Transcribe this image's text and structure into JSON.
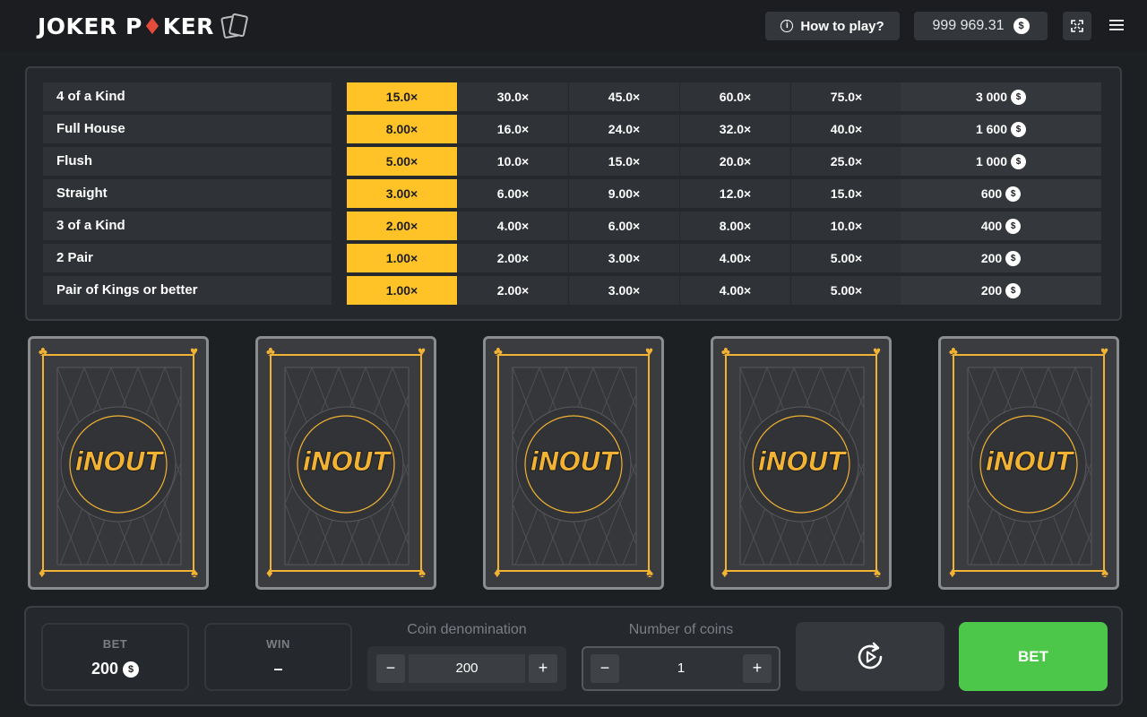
{
  "header": {
    "logo_text_1": "JOKER P",
    "logo_diamond": "♦",
    "logo_text_2": "KER",
    "how_to_play": "How to play?",
    "info_icon": "i",
    "balance": "999 969.31",
    "coin_symbol": "$"
  },
  "paytable": {
    "rows": [
      {
        "name": "4 of a Kind",
        "mult": [
          "15.0×",
          "30.0×",
          "45.0×",
          "60.0×",
          "75.0×"
        ],
        "win": "3 000"
      },
      {
        "name": "Full House",
        "mult": [
          "8.00×",
          "16.0×",
          "24.0×",
          "32.0×",
          "40.0×"
        ],
        "win": "1 600"
      },
      {
        "name": "Flush",
        "mult": [
          "5.00×",
          "10.0×",
          "15.0×",
          "20.0×",
          "25.0×"
        ],
        "win": "1 000"
      },
      {
        "name": "Straight",
        "mult": [
          "3.00×",
          "6.00×",
          "9.00×",
          "12.0×",
          "15.0×"
        ],
        "win": "600"
      },
      {
        "name": "3 of a Kind",
        "mult": [
          "2.00×",
          "4.00×",
          "6.00×",
          "8.00×",
          "10.0×"
        ],
        "win": "400"
      },
      {
        "name": "2 Pair",
        "mult": [
          "1.00×",
          "2.00×",
          "3.00×",
          "4.00×",
          "5.00×"
        ],
        "win": "200"
      },
      {
        "name": "Pair of Kings or better",
        "mult": [
          "1.00×",
          "2.00×",
          "3.00×",
          "4.00×",
          "5.00×"
        ],
        "win": "200"
      }
    ],
    "active_column": 0
  },
  "cards": {
    "brand_1": "iN",
    "brand_2": "OUT",
    "suits": {
      "top_left": "♣",
      "top_right": "♥",
      "bottom_left": "♦",
      "bottom_right": "♠"
    }
  },
  "controls": {
    "bet_label": "BET",
    "bet_value": "200",
    "win_label": "WIN",
    "win_value": "–",
    "coin_denomination_label": "Coin denomination",
    "coin_denomination_value": "200",
    "number_of_coins_label": "Number of coins",
    "number_of_coins_value": "1",
    "minus": "−",
    "plus": "+",
    "bet_button": "BET"
  },
  "colors": {
    "accent_yellow": "#ffc327",
    "bet_green": "#4cc74a",
    "card_gold": "#f2b233",
    "logo_red": "#e34b3a"
  },
  "icons": [
    "info-icon",
    "coin-icon",
    "fullscreen-icon",
    "menu-icon",
    "autoplay-icon",
    "club-icon",
    "heart-icon",
    "diamond-icon",
    "spade-icon"
  ]
}
